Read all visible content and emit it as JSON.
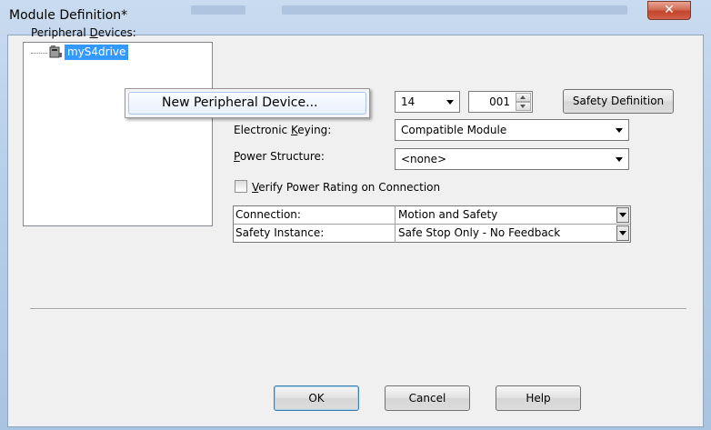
{
  "window": {
    "title": "Module Definition*",
    "close_glyph": "✕"
  },
  "peripheral": {
    "label_pre": "Peripheral ",
    "label_u": "D",
    "label_post": "evices:",
    "tree_item": "myS4drive",
    "tree_icon": "drive-module-icon"
  },
  "context_menu": {
    "item": "New Peripheral Device..."
  },
  "revision": {
    "major": "14",
    "minor": "001"
  },
  "buttons": {
    "safety_definition": "Safety Definition",
    "ok": "OK",
    "cancel": "Cancel",
    "help": "Help"
  },
  "keying": {
    "label_pre": "Electronic ",
    "label_u": "K",
    "label_post": "eying:",
    "value": "Compatible Module"
  },
  "power": {
    "label_pre": "",
    "label_u": "P",
    "label_post": "ower Structure:",
    "value": "<none>"
  },
  "verify": {
    "label_pre": "",
    "label_u": "V",
    "label_post": "erify Power Rating on Connection",
    "checked": false
  },
  "grid": {
    "rows": [
      {
        "key": "Connection:",
        "value": "Motion and Safety"
      },
      {
        "key": "Safety Instance:",
        "value": "Safe Stop Only - No Feedback"
      }
    ]
  },
  "colors": {
    "selection": "#3399ff",
    "dialog_bg": "#f0f0f0",
    "frame": "#b8cfe9"
  }
}
